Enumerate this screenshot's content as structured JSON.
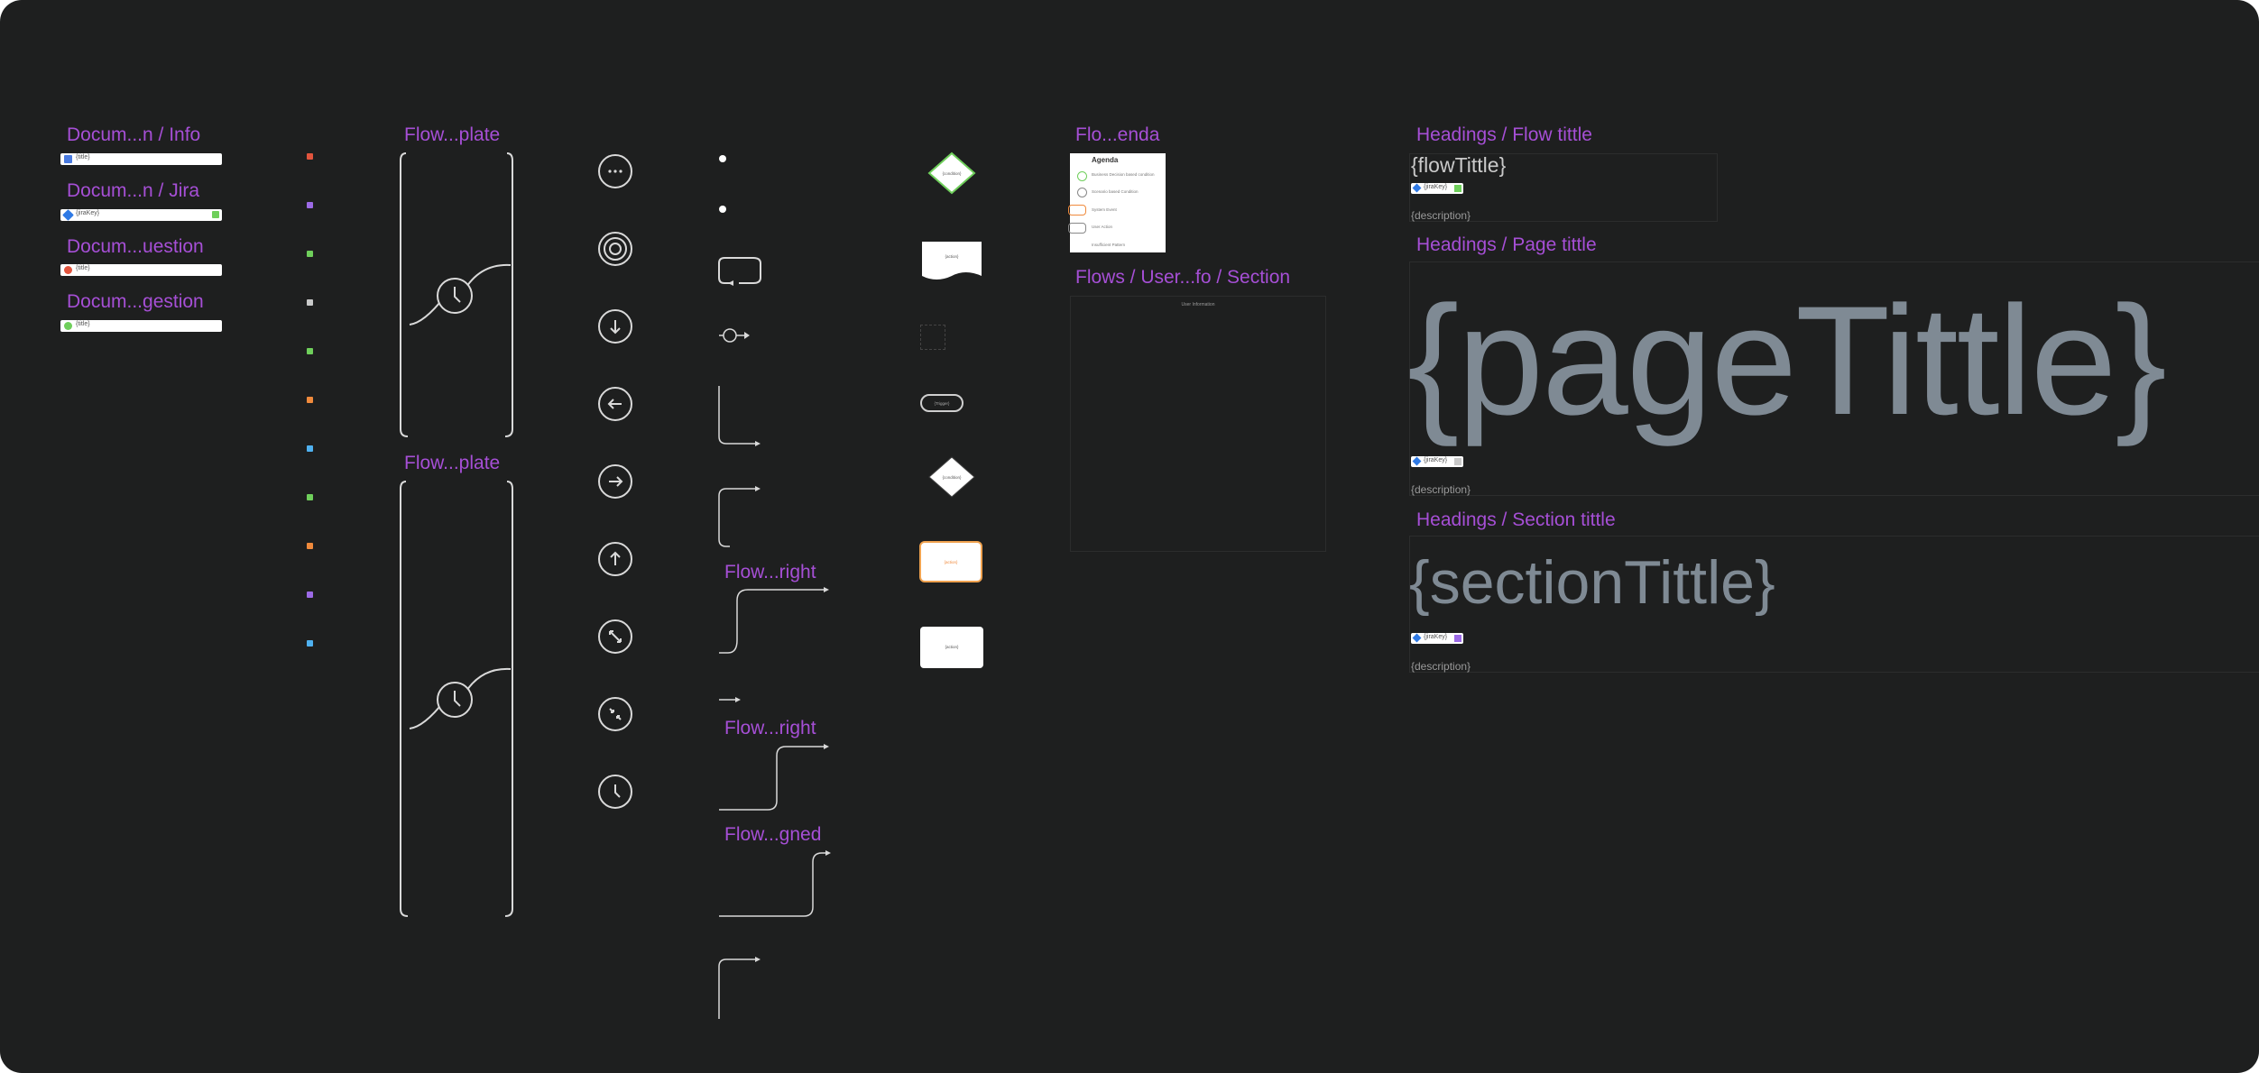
{
  "colors": {
    "background": "#1e1f1f",
    "label": "#a64fd6",
    "heading_text": "#7f8a94",
    "line": "#d9d9d9"
  },
  "doc_components": [
    {
      "label": "Docum...n / Info",
      "bar_text": "{title}",
      "icon": "document-icon"
    },
    {
      "label": "Docum...n / Jira",
      "bar_text": "{jiraKey}",
      "icon": "jira-icon"
    },
    {
      "label": "Docum...uestion",
      "bar_text": "{title}",
      "icon": "question-icon"
    },
    {
      "label": "Docum...gestion",
      "bar_text": "{title}",
      "icon": "suggestion-icon"
    }
  ],
  "dot_colors": [
    "#e2543d",
    "#9c6ae6",
    "#6fcf5b",
    "#c9c9c9",
    "#6fcf5b",
    "#f08a3c",
    "#4fb1f0",
    "#6fcf5b",
    "#f08a3c",
    "#9c6ae6",
    "#4fb1f0"
  ],
  "templates": [
    {
      "label": "Flow...plate"
    },
    {
      "label": "Flow...plate"
    }
  ],
  "icons": [
    "more-icon",
    "target-icon",
    "arrow-down-icon",
    "arrow-left-icon",
    "arrow-right-icon",
    "arrow-up-icon",
    "expand-icon",
    "collapse-icon",
    "clock-icon"
  ],
  "connectors": [
    {
      "label": "Flow...right"
    },
    {
      "label": "Flow...right"
    },
    {
      "label": "Flow...gned"
    }
  ],
  "shapes": {
    "condition": "{condition}",
    "action": "{action}",
    "trigger": "{Trigger}",
    "condition2": "{condition}",
    "orange": "{action}",
    "action2": "{action}"
  },
  "agenda": {
    "label": "Flo...enda",
    "title": "Agenda",
    "items": [
      "Business Decision based condition",
      "Scenario based Condition",
      "System Event",
      "User Action",
      "Insufficient Pattern"
    ]
  },
  "user_info": {
    "label": "Flows / User...fo / Section",
    "inner_title": "User Information"
  },
  "headings": {
    "flow": {
      "label": "Headings / Flow tittle",
      "title": "{flowTittle}",
      "jira": "{jiraKey}",
      "description": "{description}"
    },
    "page": {
      "label": "Headings / Page tittle",
      "title": "{pageTittle}",
      "jira": "{jiraKey}",
      "description": "{description}"
    },
    "section": {
      "label": "Headings / Section tittle",
      "title": "{sectionTittle}",
      "jira": "{jiraKey}",
      "description": "{description}"
    }
  }
}
